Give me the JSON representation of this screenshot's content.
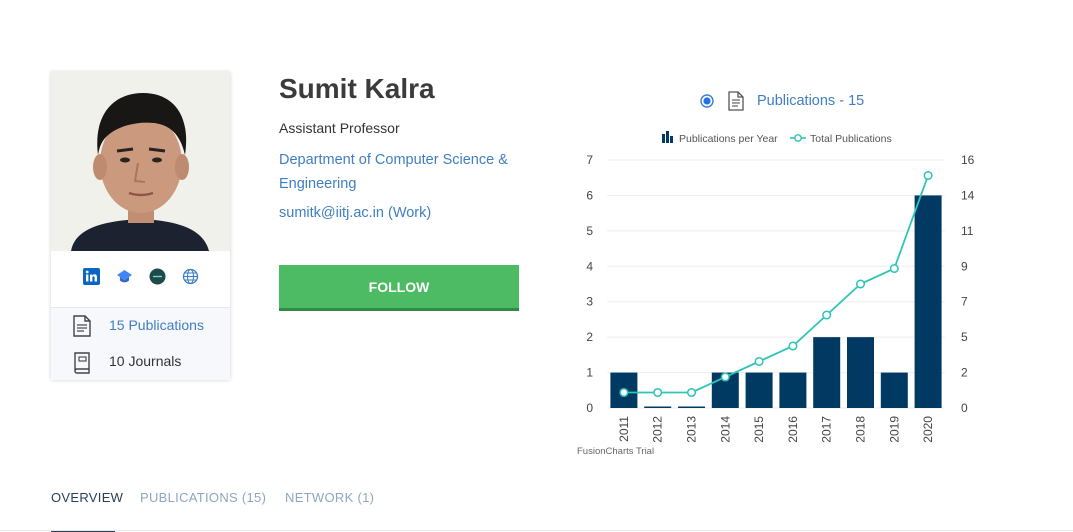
{
  "profile": {
    "name": "Sumit Kalra",
    "role": "Assistant Professor",
    "department": "Department of Computer Science & Engineering",
    "email": "sumitk@iitj.ac.in (Work)",
    "follow_label": "FOLLOW",
    "socials": [
      "linkedin-icon",
      "scholar-cap-icon",
      "researchgate-icon",
      "globe-icon"
    ],
    "stats": {
      "publications": "15 Publications",
      "journals": "10 Journals"
    }
  },
  "chart_header": {
    "label": "Publications - 15"
  },
  "chart_data": {
    "type": "bar",
    "categories": [
      "2011",
      "2012",
      "2013",
      "2014",
      "2015",
      "2016",
      "2017",
      "2018",
      "2019",
      "2020"
    ],
    "series": [
      {
        "name": "Publications per Year",
        "type": "bar",
        "axis": "left",
        "values": [
          1,
          0,
          0,
          1,
          1,
          1,
          2,
          2,
          1,
          6
        ]
      },
      {
        "name": "Total Publications",
        "type": "line",
        "axis": "right",
        "values": [
          1,
          1,
          1,
          2,
          3,
          4,
          6,
          8,
          9,
          15
        ]
      }
    ],
    "y_left_ticks": [
      "0",
      "1",
      "2",
      "3",
      "4",
      "5",
      "6",
      "7"
    ],
    "y_right_ticks": [
      "0",
      "2",
      "5",
      "7",
      "9",
      "11",
      "14",
      "16"
    ],
    "ylim_left": [
      0,
      7
    ],
    "ylim_right": [
      0,
      16
    ],
    "legend_position": "top",
    "watermark": "FusionCharts Trial",
    "colors": {
      "bar": "#003a63",
      "line": "#2ec4b6",
      "grid": "#eeeeee"
    }
  },
  "tabs": [
    {
      "label": "OVERVIEW"
    },
    {
      "label": "PUBLICATIONS (15)"
    },
    {
      "label": "NETWORK (1)"
    }
  ],
  "colors": {
    "accent": "#3f7fc1",
    "follow": "#4cbb63",
    "tab_active": "#2a3f57"
  }
}
